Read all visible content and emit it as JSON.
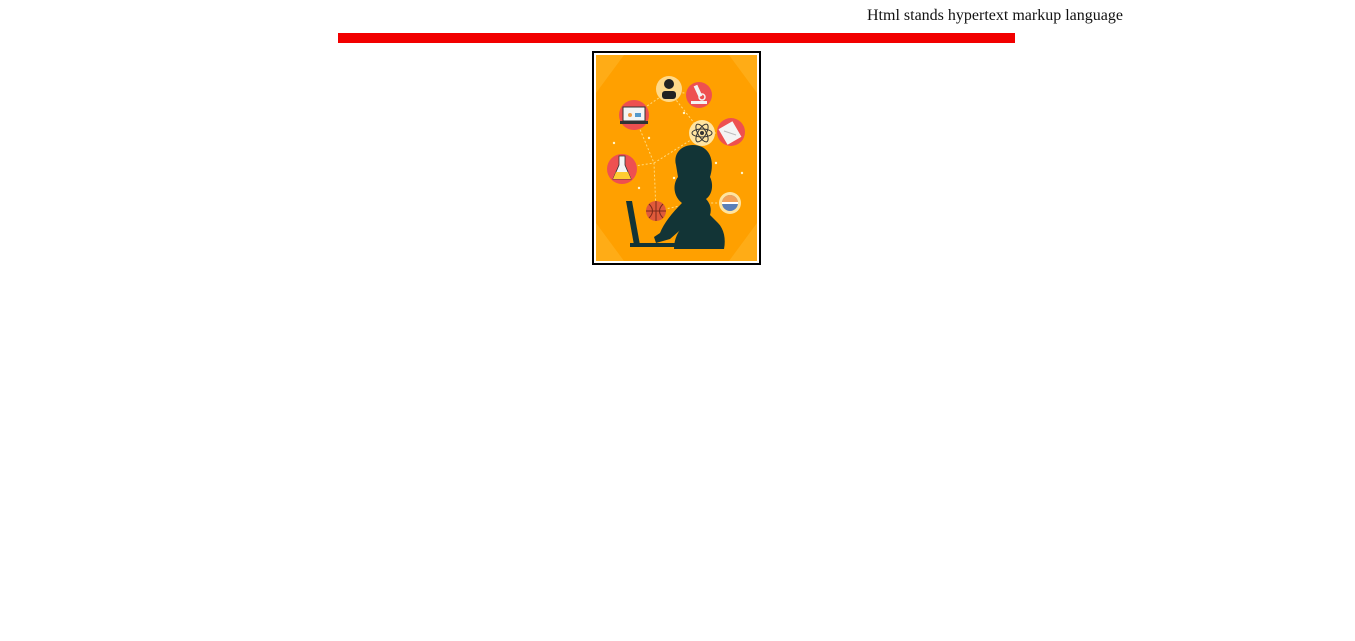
{
  "header": {
    "caption": "Html stands hypertext markup language"
  },
  "divider": {
    "color": "#f20000"
  },
  "illustration": {
    "subject": "person-at-laptop-with-stem-icons",
    "background_color": "#ffa000",
    "silhouette_color": "#123436",
    "icons": [
      "laptop-icon",
      "person-icon",
      "microscope-icon",
      "atom-icon",
      "book-icon",
      "flask-icon",
      "basketball-icon",
      "globe-icon"
    ]
  }
}
